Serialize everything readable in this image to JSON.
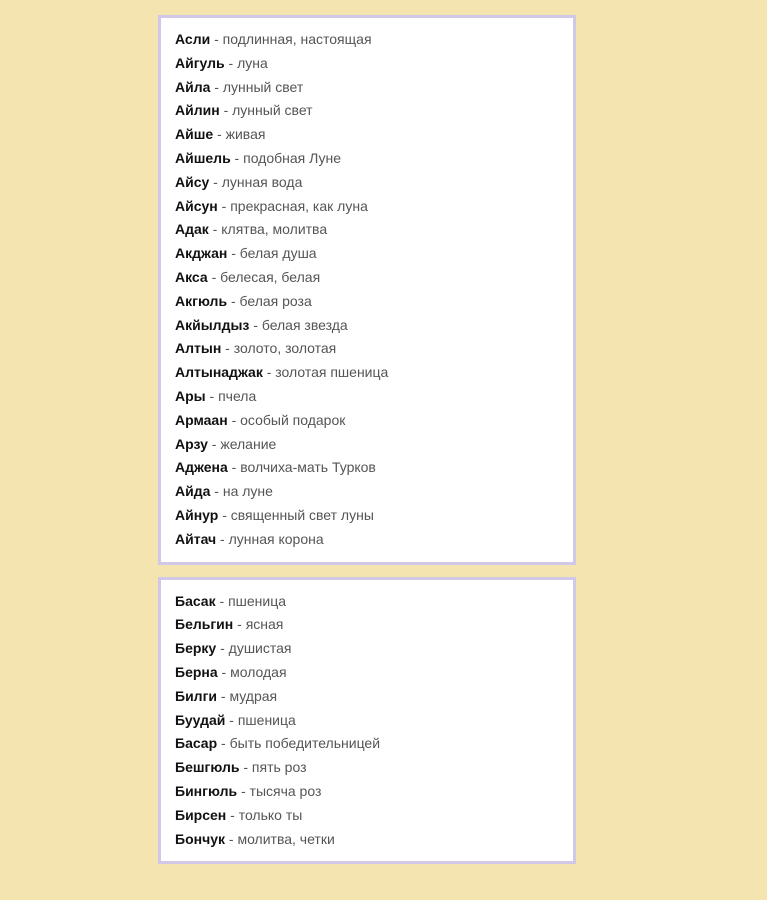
{
  "groups": [
    {
      "entries": [
        {
          "name": "Асли",
          "meaning": "подлинная, настоящая"
        },
        {
          "name": "Айгуль",
          "meaning": "луна"
        },
        {
          "name": "Айла",
          "meaning": "лунный свет"
        },
        {
          "name": "Айлин",
          "meaning": "лунный свет"
        },
        {
          "name": "Айше",
          "meaning": "живая"
        },
        {
          "name": "Айшель",
          "meaning": "подобная Луне"
        },
        {
          "name": "Айсу",
          "meaning": "лунная вода"
        },
        {
          "name": "Айсун",
          "meaning": "прекрасная, как луна"
        },
        {
          "name": "Адак",
          "meaning": "клятва, молитва"
        },
        {
          "name": "Акджан",
          "meaning": "белая душа"
        },
        {
          "name": "Акса",
          "meaning": "белесая, белая"
        },
        {
          "name": "Акгюль",
          "meaning": "белая роза"
        },
        {
          "name": "Акйылдыз",
          "meaning": "белая звезда"
        },
        {
          "name": "Алтын",
          "meaning": "золото, золотая"
        },
        {
          "name": "Алтынаджак",
          "meaning": "золотая пшеница"
        },
        {
          "name": "Ары",
          "meaning": "пчела"
        },
        {
          "name": "Армаан",
          "meaning": "особый подарок"
        },
        {
          "name": "Арзу",
          "meaning": "желание"
        },
        {
          "name": "Аджена",
          "meaning": "волчиха-мать Турков"
        },
        {
          "name": "Айда",
          "meaning": "на луне"
        },
        {
          "name": "Айнур",
          "meaning": "священный свет луны"
        },
        {
          "name": "Айтач",
          "meaning": "лунная корона"
        }
      ]
    },
    {
      "entries": [
        {
          "name": "Басак",
          "meaning": "пшеница"
        },
        {
          "name": "Бельгин",
          "meaning": "ясная"
        },
        {
          "name": "Берку",
          "meaning": "душистая"
        },
        {
          "name": "Берна",
          "meaning": "молодая"
        },
        {
          "name": "Билги",
          "meaning": "мудрая"
        },
        {
          "name": "Буудай",
          "meaning": "пшеница"
        },
        {
          "name": "Басар",
          "meaning": "быть победительницей"
        },
        {
          "name": "Бешгюль",
          "meaning": "пять роз"
        },
        {
          "name": "Бингюль",
          "meaning": "тысяча роз"
        },
        {
          "name": "Бирсен",
          "meaning": "только ты"
        },
        {
          "name": "Бончук",
          "meaning": "молитва, четки"
        }
      ]
    }
  ],
  "separator": " - "
}
